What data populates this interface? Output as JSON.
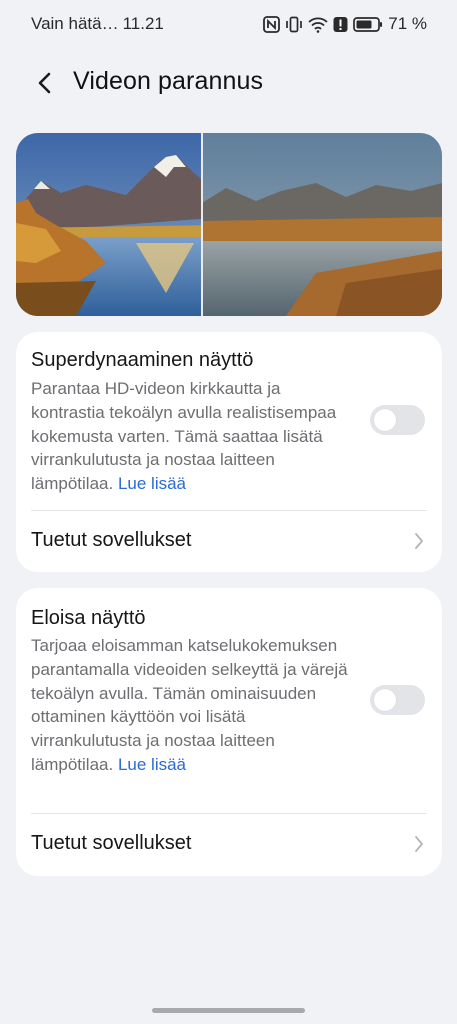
{
  "status_bar": {
    "carrier": "Vain hätä…",
    "time": "11.21",
    "battery": "71 %",
    "icons": [
      "nfc-icon",
      "vibrate-icon",
      "wifi-icon",
      "alert-icon",
      "battery-icon"
    ]
  },
  "header": {
    "title": "Videon parannus",
    "back_icon": "back-arrow-icon"
  },
  "hero": {
    "description": "Landscape comparison image: mountain, autumn trees and lake, split in two halves"
  },
  "sections": [
    {
      "title": "Superdynaaminen näyttö",
      "description": "Parantaa HD-videon kirkkautta ja kontrastia tekoälyn avulla realistisempaa kokemusta varten. Tämä saattaa lisätä virrankulutusta ja nostaa laitteen lämpötilaa.",
      "link": "Lue lisää",
      "toggle_on": false,
      "row_label": "Tuetut sovellukset"
    },
    {
      "title": "Eloisa näyttö",
      "description": "Tarjoaa eloisamman katselukokemuksen parantamalla videoiden selkeyttä ja värejä tekoälyn avulla. Tämän ominaisuuden ottaminen käyttöön voi lisätä virrankulutusta ja nostaa laitteen lämpötilaa.",
      "link": "Lue lisää",
      "toggle_on": false,
      "row_label": "Tuetut sovellukset"
    }
  ],
  "colors": {
    "background": "#f1f2f6",
    "card": "#ffffff",
    "link": "#2a6bd6",
    "toggle_off": "#e3e4e8"
  }
}
